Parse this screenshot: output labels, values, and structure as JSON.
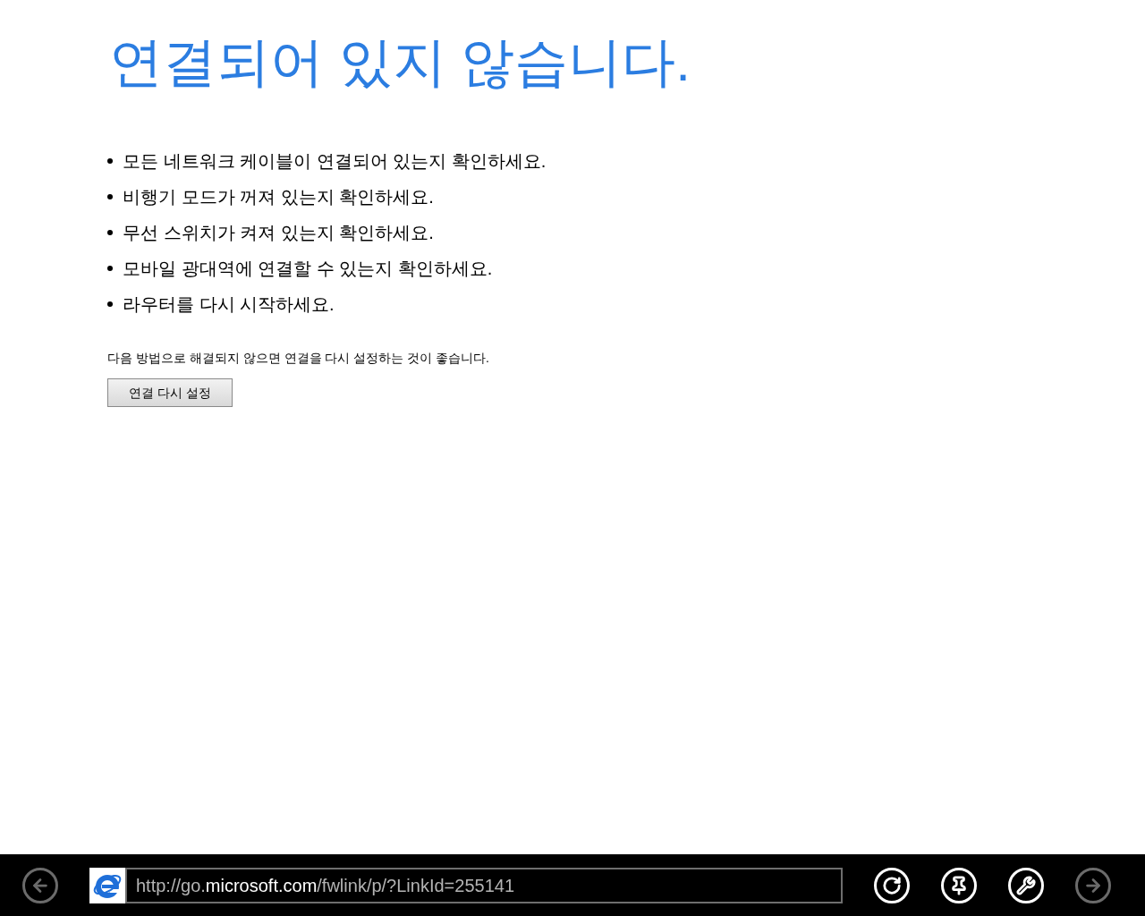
{
  "heading": "연결되어 있지 않습니다.",
  "tips": [
    "모든 네트워크 케이블이 연결되어 있는지 확인하세요.",
    "비행기 모드가 꺼져 있는지 확인하세요.",
    "무선 스위치가 켜져 있는지 확인하세요.",
    "모바일 광대역에 연결할 수 있는지 확인하세요.",
    "라우터를 다시 시작하세요."
  ],
  "note": "다음 방법으로 해결되지 않으면 연결을 다시 설정하는 것이 좋습니다.",
  "reset_button": "연결 다시 설정",
  "address_bar": {
    "back_disabled": true,
    "url": "http://go.**microsoft.com**/fwlink/p/?LinkId=255141",
    "tools": [
      {
        "kind": "refresh",
        "disabled": false
      },
      {
        "kind": "pin",
        "disabled": false
      },
      {
        "kind": "tools",
        "disabled": false
      },
      {
        "kind": "forward",
        "disabled": true
      }
    ]
  }
}
